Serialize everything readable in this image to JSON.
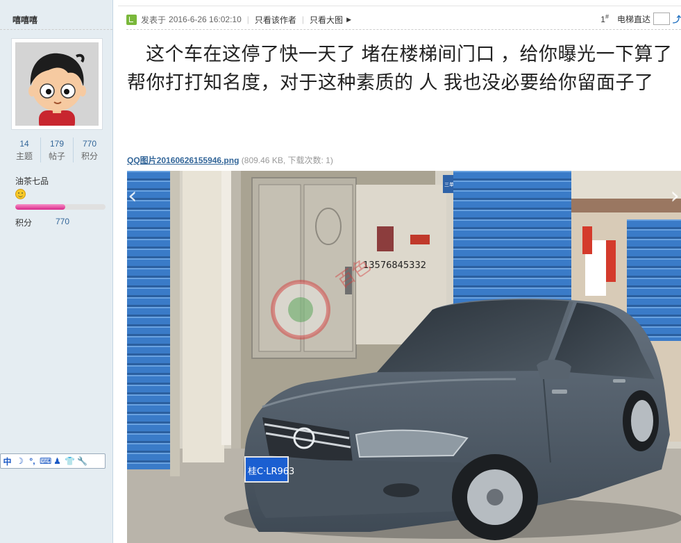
{
  "user": {
    "name": "嘻嘻嘻",
    "stats": [
      {
        "value": "14",
        "label": "主题"
      },
      {
        "value": "179",
        "label": "帖子"
      },
      {
        "value": "770",
        "label": "积分"
      }
    ],
    "rank": "油茶七品",
    "progress_fraction": 0.55,
    "credit_label": "积分",
    "credit_value": "770"
  },
  "post_meta": {
    "posted_prefix": "发表于",
    "posted_time": "2016-6-26 16:02:10",
    "author_only": "只看该作者",
    "view_large": "只看大图",
    "floor_number": "1",
    "floor_mark": "#",
    "elevator_label": "电梯直达"
  },
  "post": {
    "text": "这个车在这停了快一天了 堵在楼梯间门口 ，给你曝光一下算了 帮你打打知名度，对于这种素质的 人 我也没必要给你留面子了"
  },
  "attachment": {
    "filename": "QQ图片20160626155946.png",
    "info": "(809.46 KB, 下载次数: 1)"
  },
  "photo": {
    "plate_text": "桂C·LR963",
    "phone_graffiti": "13576845332",
    "sign_text": "三单元"
  },
  "ime_bar": {
    "lang": "中"
  },
  "colors": {
    "link": "#336699",
    "shutter": "#3d7cc9",
    "car": "#4e5b68",
    "progress": "#d9298a"
  }
}
